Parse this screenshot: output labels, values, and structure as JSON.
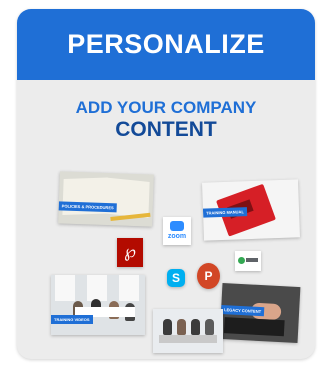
{
  "card": {
    "title": "PERSONALIZE",
    "subtitle_line1": "ADD YOUR COMPANY",
    "subtitle_line2": "CONTENT"
  },
  "collage": {
    "policies_tag": "POLICIES & PROCEDURES",
    "manual_tag": "TRAINING MANUAL",
    "zoom_label": "zoom",
    "videos_tag": "TRAINING VIDEOS",
    "legacy_tag": "LEGACY CONTENT",
    "skype_letter": "S",
    "ppt_letter": "P"
  },
  "colors": {
    "brand_blue": "#1f6fd6",
    "navy": "#134a98",
    "card_bg": "#ececec"
  }
}
